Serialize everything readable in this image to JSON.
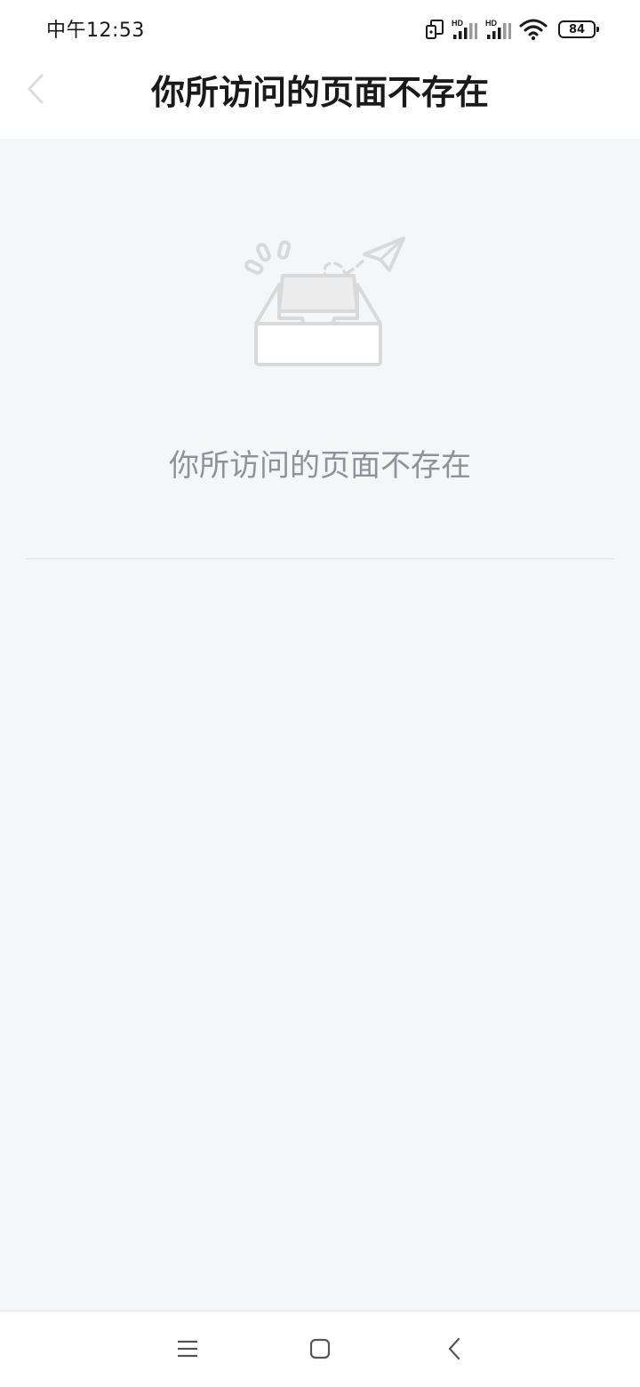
{
  "status_bar": {
    "time": "中午12:53",
    "network_labels": [
      "HD",
      "HD"
    ],
    "battery_level": "84",
    "icons": [
      "dual-window-icon",
      "signal-strength-icon",
      "signal-strength-icon",
      "wifi-icon",
      "battery-icon"
    ]
  },
  "header": {
    "title": "你所访问的页面不存在",
    "back_icon": "chevron-left-icon"
  },
  "main": {
    "illustration_icon": "empty-inbox-paper-plane-icon",
    "message": "你所访问的页面不存在"
  },
  "system_nav": {
    "icons": [
      "menu-icon",
      "home-icon",
      "back-icon"
    ]
  },
  "colors": {
    "background": "#f4f6f8",
    "surface": "#ffffff",
    "title_text": "#1a1a1a",
    "message_text": "#8f9399",
    "illustration_stroke": "#d9d9d9",
    "divider": "#e3e5e8"
  }
}
